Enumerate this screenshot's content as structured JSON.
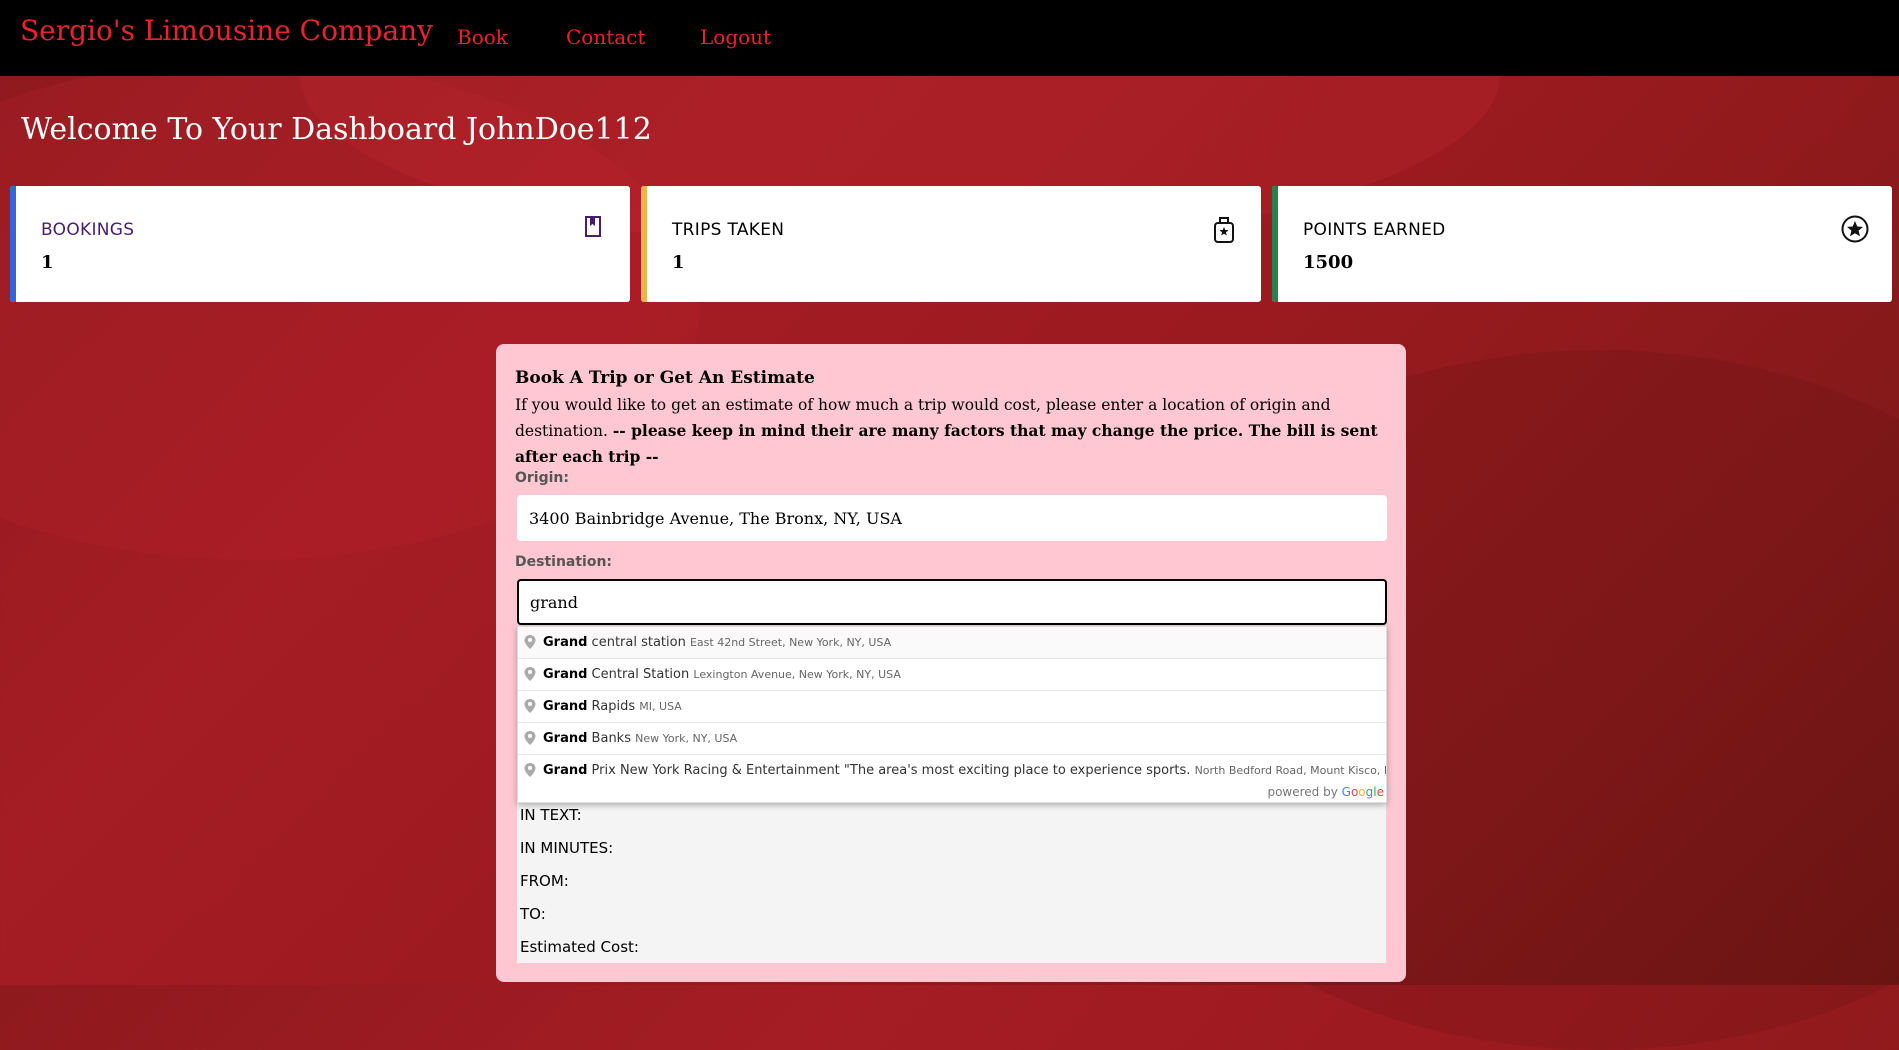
{
  "navbar": {
    "brand": "Sergio's Limousine Company",
    "links": [
      "Book",
      "Contact",
      "Logout"
    ]
  },
  "welcome": "Welcome To Your Dashboard JohnDoe112",
  "cards": [
    {
      "label": "BOOKINGS",
      "value": "1",
      "accent": "#3366dd",
      "label_color": "#4a1c6e",
      "icon": "bookmark-book-icon"
    },
    {
      "label": "TRIPS TAKEN",
      "value": "1",
      "accent": "#f0b34a",
      "label_color": "#111111",
      "icon": "luggage-icon"
    },
    {
      "label": "POINTS EARNED",
      "value": "1500",
      "accent": "#2e7d4f",
      "label_color": "#111111",
      "icon": "star-circle-icon"
    }
  ],
  "panel": {
    "title": "Book A Trip or Get An Estimate",
    "desc": "If you would like to get an estimate of how much a trip would cost, please enter a location of origin and destination.",
    "desc_bold": "-- please keep in mind their are many factors that may change the price. The bill is sent after each trip --",
    "origin_label": "Origin:",
    "origin_value": "3400 Bainbridge Avenue, The Bronx, NY, USA",
    "destination_label": "Destination:",
    "destination_value": "grand",
    "results": [
      "IN TEXT:",
      "IN MINUTES:",
      "FROM:",
      "TO:",
      "Estimated Cost:"
    ]
  },
  "autocomplete": {
    "items": [
      {
        "match": "Grand",
        "rest": " central station",
        "secondary": "East 42nd Street, New York, NY, USA"
      },
      {
        "match": "Grand",
        "rest": " Central Station",
        "secondary": "Lexington Avenue, New York, NY, USA"
      },
      {
        "match": "Grand",
        "rest": " Rapids",
        "secondary": "MI, USA"
      },
      {
        "match": "Grand",
        "rest": " Banks",
        "secondary": "New York, NY, USA"
      },
      {
        "match": "Grand",
        "rest": " Prix New York Racing & Entertainment \"The area's most exciting place to experience sports.",
        "secondary": "North Bedford Road, Mount Kisco, NY, USA"
      }
    ],
    "footer_prefix": "powered by",
    "footer_brand": [
      "G",
      "o",
      "o",
      "g",
      "l",
      "e"
    ]
  },
  "colors": {
    "brand": "#e8232e",
    "panel": "#fec7d1",
    "navbar": "#000000"
  }
}
